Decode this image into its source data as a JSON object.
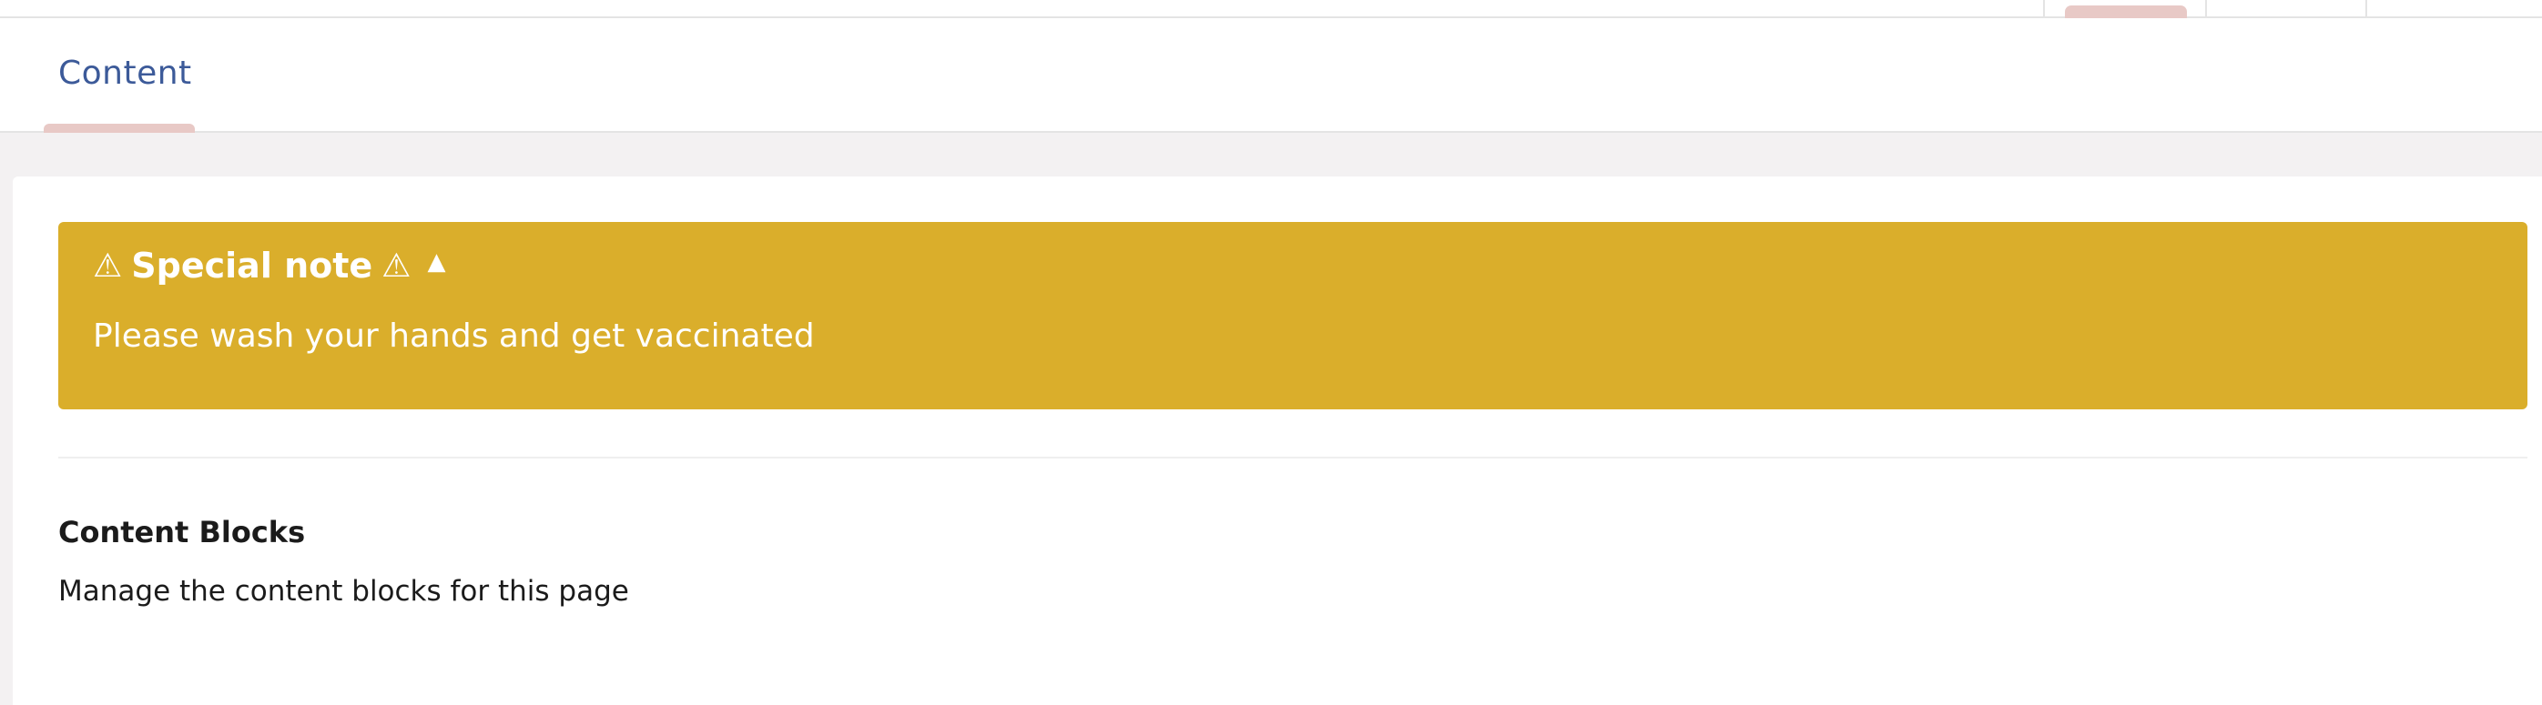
{
  "tabs": {
    "active_label": "Content"
  },
  "alert": {
    "warning_icon": "⚠",
    "title": "Special note",
    "toggle_icon": "▲",
    "message": "Please wash your hands and get vaccinated",
    "color": "#daae2b"
  },
  "section": {
    "title": "Content Blocks",
    "description": "Manage the content blocks for this page"
  },
  "theme": {
    "accent": "#3c5a99",
    "tab_indicator": "#e8c9c6",
    "background": "#f3f1f2"
  }
}
